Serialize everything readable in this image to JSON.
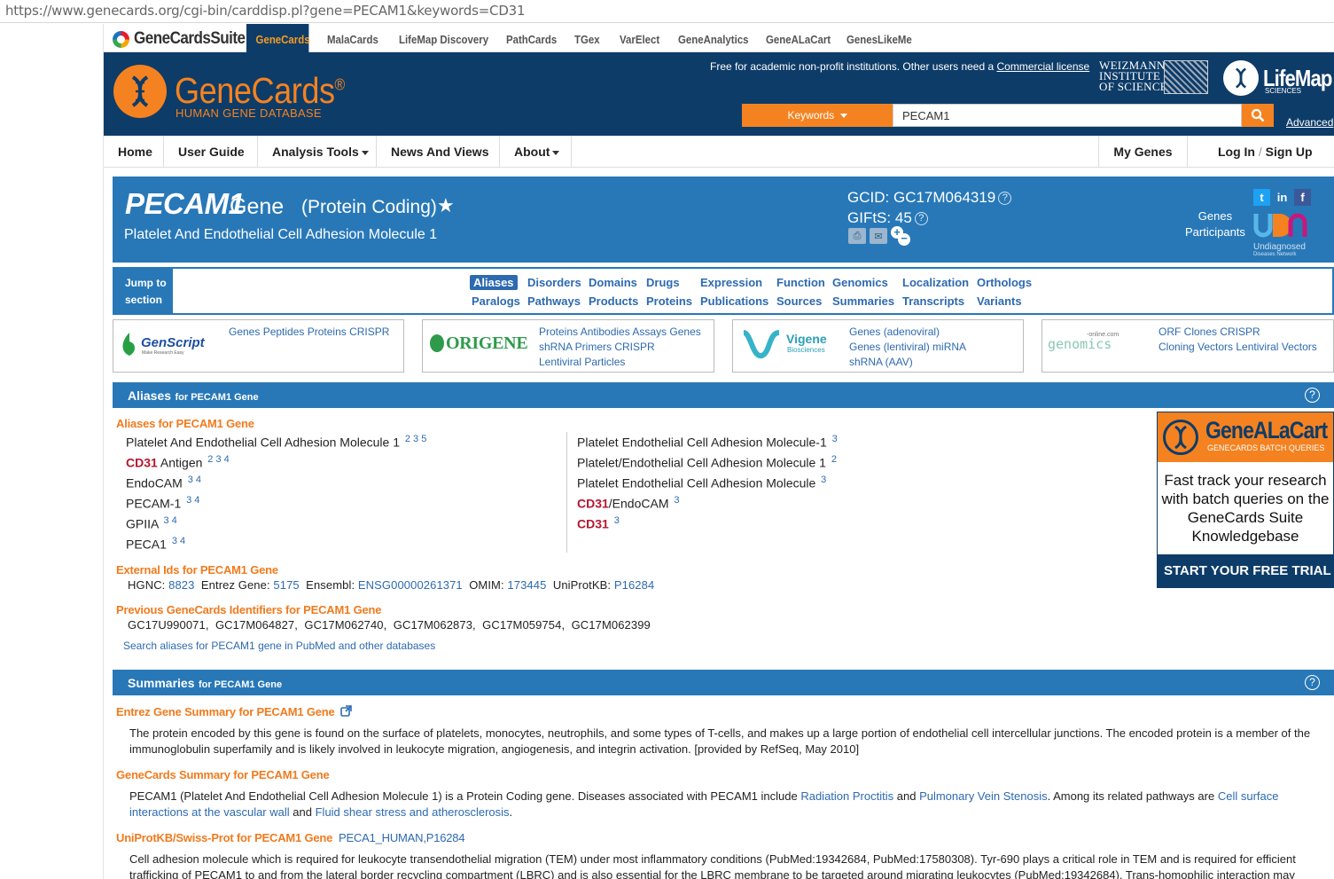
{
  "browser": {
    "url": "https://www.genecards.org/cgi-bin/carddisp.pl?gene=PECAM1&keywords=CD31"
  },
  "suite": {
    "logo": "GeneCardsSuite",
    "tabs": [
      "GeneCards",
      "MalaCards",
      "LifeMap Discovery",
      "PathCards",
      "TGex",
      "VarElect",
      "GeneAnalytics",
      "GeneALaCart",
      "GenesLikeMe"
    ]
  },
  "header": {
    "logo_title": "GeneCards",
    "logo_reg": "®",
    "logo_sub": "HUMAN GENE DATABASE",
    "free_text": "Free for academic non-profit institutions. Other users need a",
    "commercial_link": "Commercial license",
    "weizmann": [
      "WEIZMANN",
      "INSTITUTE",
      "OF SCIENCE"
    ],
    "lifemap": "LifeMap",
    "lifemap_sub": "SCIENCES",
    "keywords_btn": "Keywords",
    "search_value": "PECAM1",
    "advanced": "Advanced"
  },
  "nav": {
    "home": "Home",
    "user_guide": "User Guide",
    "analysis_tools": "Analysis Tools",
    "news": "News And Views",
    "about": "About",
    "my_genes": "My Genes",
    "login": "Log In",
    "slash": "/",
    "signup": "Sign Up"
  },
  "gene": {
    "symbol": "PECAM1",
    "word": "Gene",
    "category": "(Protein Coding)",
    "fullname": "Platelet And Endothelial Cell Adhesion Molecule 1",
    "gcid_label": "GCID:",
    "gcid": "GC17M064319",
    "gifts_label": "GIFtS:",
    "gifts": "45",
    "participants_1": "Genes",
    "participants_2": "Participants",
    "udn_1": "Undiagnosed",
    "udn_2": "Diseases Network"
  },
  "jump": {
    "label_1": "Jump to",
    "label_2": "section",
    "row1": [
      "Aliases",
      "Disorders",
      "Domains",
      "Drugs",
      "Expression",
      "Function",
      "Genomics",
      "Localization",
      "Orthologs"
    ],
    "row2": [
      "Paralogs",
      "Pathways",
      "Products",
      "Proteins",
      "Publications",
      "Sources",
      "Summaries",
      "Transcripts",
      "Variants"
    ]
  },
  "ads": [
    {
      "brand": "GenScript",
      "tagline": "Make Research Easy",
      "lines": [
        "Genes Peptides Proteins CRISPR"
      ]
    },
    {
      "brand": "ORIGENE",
      "lines": [
        "Proteins Antibodies Assays Genes",
        "shRNA Primers CRISPR",
        "Lentiviral Particles"
      ]
    },
    {
      "brand": "Vigene",
      "tagline": "Biosciences",
      "lines": [
        "Genes (adenoviral)",
        "Genes (lentiviral) miRNA",
        "shRNA (AAV)"
      ]
    },
    {
      "brand": "genomics",
      "tagline": "-online.com",
      "lines": [
        "ORF Clones CRISPR",
        "Cloning Vectors Lentiviral Vectors"
      ]
    }
  ],
  "aliases_section": {
    "title": "Aliases",
    "title_small": "for PECAM1 Gene",
    "subhead": "Aliases for PECAM1 Gene",
    "left": [
      {
        "pre": "Platelet And Endothelial Cell Adhesion Molecule 1",
        "red": "",
        "post": "",
        "sup": "2 3 5"
      },
      {
        "pre": "",
        "red": "CD31",
        "post": " Antigen",
        "sup": "2 3 4"
      },
      {
        "pre": "EndoCAM",
        "red": "",
        "post": "",
        "sup": "3 4"
      },
      {
        "pre": "PECAM-1",
        "red": "",
        "post": "",
        "sup": "3 4"
      },
      {
        "pre": "GPIIA",
        "red": "",
        "post": "",
        "sup": "3 4"
      },
      {
        "pre": "PECA1",
        "red": "",
        "post": "",
        "sup": "3 4"
      }
    ],
    "right": [
      {
        "pre": "Platelet Endothelial Cell Adhesion Molecule-1",
        "red": "",
        "post": "",
        "sup": "3"
      },
      {
        "pre": "Platelet/Endothelial Cell Adhesion Molecule 1",
        "red": "",
        "post": "",
        "sup": "2"
      },
      {
        "pre": "Platelet Endothelial Cell Adhesion Molecule",
        "red": "",
        "post": "",
        "sup": "3"
      },
      {
        "pre": "",
        "red": "CD31",
        "post": "/EndoCAM",
        "sup": "3"
      },
      {
        "pre": "",
        "red": "CD31",
        "post": "",
        "sup": "3"
      }
    ],
    "external_head": "External Ids for PECAM1 Gene",
    "ext": {
      "hgnc_l": "HGNC:",
      "hgnc": "8823",
      "entrez_l": "Entrez Gene:",
      "entrez": "5175",
      "ensembl_l": "Ensembl:",
      "ensembl": "ENSG00000261371",
      "omim_l": "OMIM:",
      "omim": "173445",
      "uniprot_l": "UniProtKB:",
      "uniprot": "P16284"
    },
    "prev_head": "Previous GeneCards Identifiers for PECAM1 Gene",
    "prev_ids": "GC17U990071,  GC17M064827,  GC17M062740,  GC17M062873,  GC17M059754,  GC17M062399",
    "search_link": "Search aliases for PECAM1 gene in PubMed and other databases"
  },
  "genealacart_ad": {
    "title": "GeneALaCart",
    "sub": "GENECARDS BATCH QUERIES",
    "body": "Fast track your research with batch queries on the GeneCards Suite Knowledgebase",
    "cta": "START YOUR FREE TRIAL >>"
  },
  "summaries_section": {
    "title": "Summaries",
    "title_small": "for PECAM1 Gene",
    "entrez_head": "Entrez Gene Summary for PECAM1 Gene",
    "entrez_text": "The protein encoded by this gene is found on the surface of platelets, monocytes, neutrophils, and some types of T-cells, and makes up a large portion of endothelial cell intercellular junctions. The encoded protein is a member of the immunoglobulin superfamily and is likely involved in leukocyte migration, angiogenesis, and integrin activation. [provided by RefSeq, May 2010]",
    "gc_head": "GeneCards Summary for PECAM1 Gene",
    "gc_text_1": "PECAM1 (Platelet And Endothelial Cell Adhesion Molecule 1) is a Protein Coding gene. Diseases associated with PECAM1 include",
    "gc_link_1": "Radiation Proctitis",
    "gc_and_1": "and",
    "gc_link_2": "Pulmonary Vein Stenosis",
    "gc_text_2": ". Among its related pathways are",
    "gc_link_3": "Cell surface interactions at the vascular wall",
    "gc_and_2": "and",
    "gc_link_4": "Fluid shear stress and atherosclerosis",
    "gc_end": ".",
    "uniprot_head": "UniProtKB/Swiss-Prot for PECAM1 Gene",
    "uniprot_link": "PECA1_HUMAN,P16284",
    "uniprot_text": "Cell adhesion molecule which is required for leukocyte transendothelial migration (TEM) under most inflammatory conditions (PubMed:19342684, PubMed:17580308). Tyr-690 plays a critical role in TEM and is required for efficient trafficking of PECAM1 to and from the lateral border recycling compartment (LBRC) and is also essential for the LBRC membrane to be targeted around migrating leukocytes (PubMed:19342684). Trans-homophilic interaction may"
  }
}
